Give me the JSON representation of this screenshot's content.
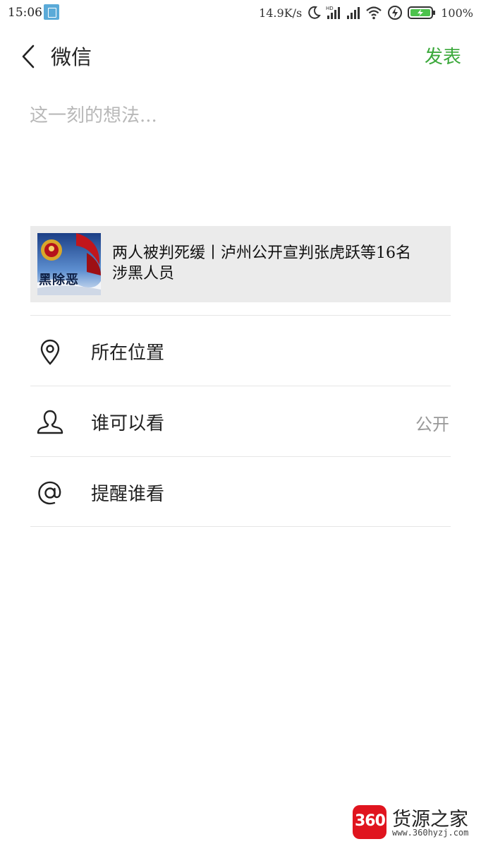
{
  "status_bar": {
    "time": "15:06",
    "network_speed": "14.9K/s",
    "battery_percent": "100%",
    "icons": [
      "calendar-icon",
      "moon-icon",
      "hd-signal-icon",
      "signal-icon",
      "wifi-icon",
      "charging-icon",
      "battery-icon"
    ]
  },
  "nav": {
    "back_icon": "chevron-left-icon",
    "title": "微信",
    "publish_label": "发表",
    "accent_color": "#3aa83a"
  },
  "post": {
    "placeholder": "这一刻的想法...",
    "value": ""
  },
  "shared_article": {
    "title": "两人被判死缓丨泸州公开宣判张虎跃等16名涉黑人员",
    "thumbnail_text": "黑除恶"
  },
  "options": [
    {
      "icon": "location-pin-icon",
      "label": "所在位置",
      "value": ""
    },
    {
      "icon": "person-icon",
      "label": "谁可以看",
      "value": "公开"
    },
    {
      "icon": "at-icon",
      "label": "提醒谁看",
      "value": ""
    }
  ],
  "watermark": {
    "badge": "360",
    "name": "货源之家",
    "url": "www.360hyzj.com"
  }
}
